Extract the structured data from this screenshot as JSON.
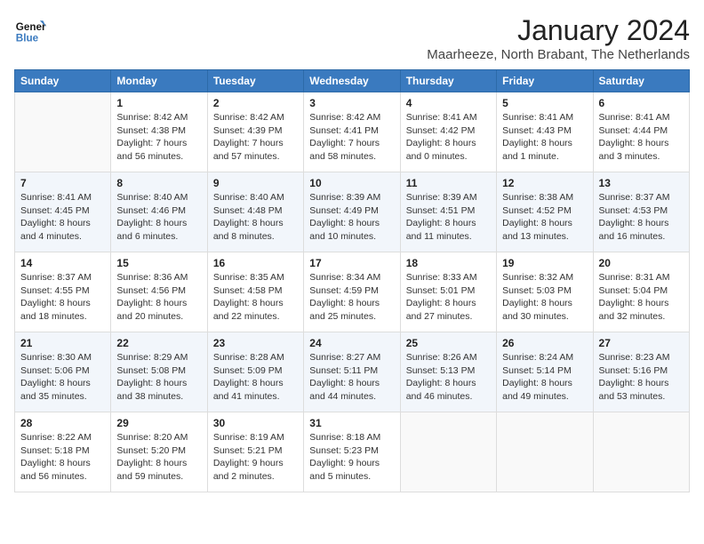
{
  "logo": {
    "line1": "General",
    "line2": "Blue"
  },
  "title": "January 2024",
  "location": "Maarheeze, North Brabant, The Netherlands",
  "days_of_week": [
    "Sunday",
    "Monday",
    "Tuesday",
    "Wednesday",
    "Thursday",
    "Friday",
    "Saturday"
  ],
  "weeks": [
    [
      {
        "day": "",
        "info": ""
      },
      {
        "day": "1",
        "info": "Sunrise: 8:42 AM\nSunset: 4:38 PM\nDaylight: 7 hours\nand 56 minutes."
      },
      {
        "day": "2",
        "info": "Sunrise: 8:42 AM\nSunset: 4:39 PM\nDaylight: 7 hours\nand 57 minutes."
      },
      {
        "day": "3",
        "info": "Sunrise: 8:42 AM\nSunset: 4:41 PM\nDaylight: 7 hours\nand 58 minutes."
      },
      {
        "day": "4",
        "info": "Sunrise: 8:41 AM\nSunset: 4:42 PM\nDaylight: 8 hours\nand 0 minutes."
      },
      {
        "day": "5",
        "info": "Sunrise: 8:41 AM\nSunset: 4:43 PM\nDaylight: 8 hours\nand 1 minute."
      },
      {
        "day": "6",
        "info": "Sunrise: 8:41 AM\nSunset: 4:44 PM\nDaylight: 8 hours\nand 3 minutes."
      }
    ],
    [
      {
        "day": "7",
        "info": "Sunrise: 8:41 AM\nSunset: 4:45 PM\nDaylight: 8 hours\nand 4 minutes."
      },
      {
        "day": "8",
        "info": "Sunrise: 8:40 AM\nSunset: 4:46 PM\nDaylight: 8 hours\nand 6 minutes."
      },
      {
        "day": "9",
        "info": "Sunrise: 8:40 AM\nSunset: 4:48 PM\nDaylight: 8 hours\nand 8 minutes."
      },
      {
        "day": "10",
        "info": "Sunrise: 8:39 AM\nSunset: 4:49 PM\nDaylight: 8 hours\nand 10 minutes."
      },
      {
        "day": "11",
        "info": "Sunrise: 8:39 AM\nSunset: 4:51 PM\nDaylight: 8 hours\nand 11 minutes."
      },
      {
        "day": "12",
        "info": "Sunrise: 8:38 AM\nSunset: 4:52 PM\nDaylight: 8 hours\nand 13 minutes."
      },
      {
        "day": "13",
        "info": "Sunrise: 8:37 AM\nSunset: 4:53 PM\nDaylight: 8 hours\nand 16 minutes."
      }
    ],
    [
      {
        "day": "14",
        "info": "Sunrise: 8:37 AM\nSunset: 4:55 PM\nDaylight: 8 hours\nand 18 minutes."
      },
      {
        "day": "15",
        "info": "Sunrise: 8:36 AM\nSunset: 4:56 PM\nDaylight: 8 hours\nand 20 minutes."
      },
      {
        "day": "16",
        "info": "Sunrise: 8:35 AM\nSunset: 4:58 PM\nDaylight: 8 hours\nand 22 minutes."
      },
      {
        "day": "17",
        "info": "Sunrise: 8:34 AM\nSunset: 4:59 PM\nDaylight: 8 hours\nand 25 minutes."
      },
      {
        "day": "18",
        "info": "Sunrise: 8:33 AM\nSunset: 5:01 PM\nDaylight: 8 hours\nand 27 minutes."
      },
      {
        "day": "19",
        "info": "Sunrise: 8:32 AM\nSunset: 5:03 PM\nDaylight: 8 hours\nand 30 minutes."
      },
      {
        "day": "20",
        "info": "Sunrise: 8:31 AM\nSunset: 5:04 PM\nDaylight: 8 hours\nand 32 minutes."
      }
    ],
    [
      {
        "day": "21",
        "info": "Sunrise: 8:30 AM\nSunset: 5:06 PM\nDaylight: 8 hours\nand 35 minutes."
      },
      {
        "day": "22",
        "info": "Sunrise: 8:29 AM\nSunset: 5:08 PM\nDaylight: 8 hours\nand 38 minutes."
      },
      {
        "day": "23",
        "info": "Sunrise: 8:28 AM\nSunset: 5:09 PM\nDaylight: 8 hours\nand 41 minutes."
      },
      {
        "day": "24",
        "info": "Sunrise: 8:27 AM\nSunset: 5:11 PM\nDaylight: 8 hours\nand 44 minutes."
      },
      {
        "day": "25",
        "info": "Sunrise: 8:26 AM\nSunset: 5:13 PM\nDaylight: 8 hours\nand 46 minutes."
      },
      {
        "day": "26",
        "info": "Sunrise: 8:24 AM\nSunset: 5:14 PM\nDaylight: 8 hours\nand 49 minutes."
      },
      {
        "day": "27",
        "info": "Sunrise: 8:23 AM\nSunset: 5:16 PM\nDaylight: 8 hours\nand 53 minutes."
      }
    ],
    [
      {
        "day": "28",
        "info": "Sunrise: 8:22 AM\nSunset: 5:18 PM\nDaylight: 8 hours\nand 56 minutes."
      },
      {
        "day": "29",
        "info": "Sunrise: 8:20 AM\nSunset: 5:20 PM\nDaylight: 8 hours\nand 59 minutes."
      },
      {
        "day": "30",
        "info": "Sunrise: 8:19 AM\nSunset: 5:21 PM\nDaylight: 9 hours\nand 2 minutes."
      },
      {
        "day": "31",
        "info": "Sunrise: 8:18 AM\nSunset: 5:23 PM\nDaylight: 9 hours\nand 5 minutes."
      },
      {
        "day": "",
        "info": ""
      },
      {
        "day": "",
        "info": ""
      },
      {
        "day": "",
        "info": ""
      }
    ]
  ]
}
